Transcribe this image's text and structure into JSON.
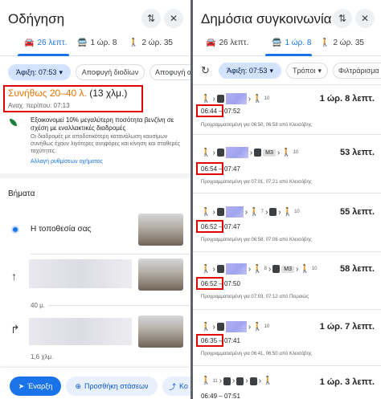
{
  "left": {
    "title": "Οδήγηση",
    "tabs": [
      {
        "label": "26 λεπτ.",
        "icon": "car-icon",
        "active": true
      },
      {
        "label": "1 ώρ. 8",
        "icon": "bus-icon",
        "active": false
      },
      {
        "label": "2 ώρ. 35",
        "icon": "walk-icon",
        "active": false
      }
    ],
    "chips": [
      "Άφιξη: 07:53",
      "Αποφυγή διοδίων",
      "Αποφυγή α"
    ],
    "summary": {
      "time": "Συνήθως 20–40 λ.",
      "distance": "(13 χλμ.)",
      "depart": "Αναχ. περίπου: 07:13"
    },
    "eco": {
      "headline": "Εξοικονομεί 10% μεγαλύτερη ποσότητα βενζίνη σε σχέση με εναλλακτικές διαδρομές",
      "body": "Οι διαδρομές με αποδοτικότερη κατανάλωση καυσίμων συνήθως έχουν λιγότερες ανηφόρες και κίνηση και σταθερές ταχύτητες.",
      "link": "Αλλαγή ρυθμίσεων οχήματος"
    },
    "steps_title": "Βήματα",
    "steps": [
      {
        "label": "Η τοποθεσία σας",
        "icon": "location-dot-icon",
        "distance": ""
      },
      {
        "label": "",
        "icon": "arrow-up-icon",
        "distance": "40 μ."
      },
      {
        "label": "",
        "icon": "turn-right-icon",
        "distance": "1,6 χλμ."
      }
    ],
    "start_button": "Έναρξη",
    "add_stops_button": "Προσθήκη στάσεων",
    "share_button": "Κο"
  },
  "right": {
    "title": "Δημόσια συγκοινωνία",
    "tabs": [
      {
        "label": "26 λεπτ.",
        "icon": "car-icon",
        "active": false
      },
      {
        "label": "1 ώρ. 8",
        "icon": "bus-icon",
        "active": true
      },
      {
        "label": "2 ώρ. 35",
        "icon": "walk-icon",
        "active": false
      }
    ],
    "chips": [
      "Άφιξη: 07:53",
      "Τρόποι",
      "Φιλτράρισμα"
    ],
    "routes": [
      {
        "dep": "06:44",
        "arr": "07:52",
        "duration": "1 ώρ. 8 λεπτ.",
        "line": "",
        "note": "Προγραμματισμένη για 06:50, 06:58 από Κλεισόβης",
        "walk1": "",
        "walk2": "10"
      },
      {
        "dep": "06:54",
        "arr": "07:47",
        "duration": "53 λεπτ.",
        "line": "M3",
        "note": "Προγραμματισμένη για 07:01, 07:21 από Κλεισόβης",
        "walk1": "",
        "walk2": "10"
      },
      {
        "dep": "06:52",
        "arr": "07:47",
        "duration": "55 λεπτ.",
        "line": "",
        "note": "Προγραμματισμένη για 06:58, 07:06 από Κλεισόβης",
        "walk1": "7",
        "walk2": "10"
      },
      {
        "dep": "06:52",
        "arr": "07:50",
        "duration": "58 λεπτ.",
        "line": "M3",
        "note": "Προγραμματισμένη για 07:03, 07:12 από Πειραιώς",
        "walk1": "8",
        "walk2": "10"
      },
      {
        "dep": "06:35",
        "arr": "07:41",
        "duration": "1 ώρ. 7 λεπτ.",
        "line": "",
        "note": "Προγραμματισμένη για 06:41, 06:50 από Κλεισόβης",
        "walk1": "",
        "walk2": "10"
      },
      {
        "dep": "06:49",
        "arr": "07:51",
        "duration": "1 ώρ. 3 λεπτ.",
        "line": "",
        "note": "",
        "walk1": "11",
        "walk2": ""
      }
    ]
  }
}
